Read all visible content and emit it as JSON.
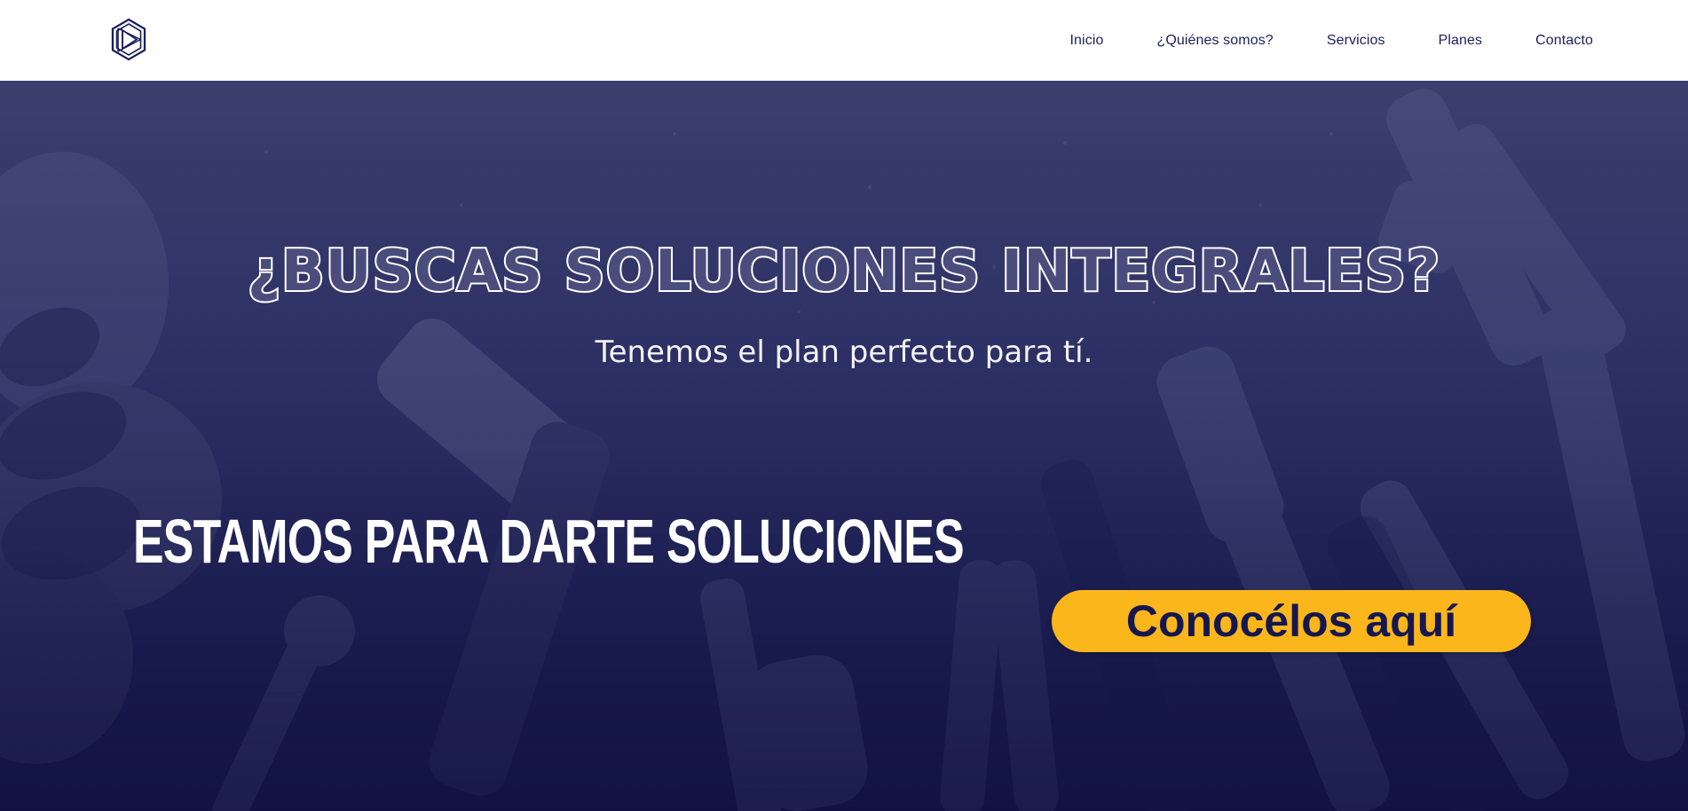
{
  "header": {
    "logo_icon": "hexagon-logo-icon",
    "nav": [
      {
        "label": "Inicio"
      },
      {
        "label": "¿Quiénes somos?"
      },
      {
        "label": "Servicios"
      },
      {
        "label": "Planes"
      },
      {
        "label": "Contacto"
      }
    ]
  },
  "hero": {
    "background": "tools-workbench-photo",
    "headline": "¿BUSCAS SOLUCIONES INTEGRALES?",
    "subheadline": "Tenemos el plan perfecto para tí.",
    "tagline": "ESTAMOS PARA DARTE SOLUCIONES",
    "cta_label": "Conocélos aquí"
  },
  "colors": {
    "brand_navy": "#1b1f5c",
    "hero_overlay": "#2b2e63",
    "cta_yellow": "#fbb61c",
    "cta_text": "#15174f",
    "white": "#ffffff"
  }
}
